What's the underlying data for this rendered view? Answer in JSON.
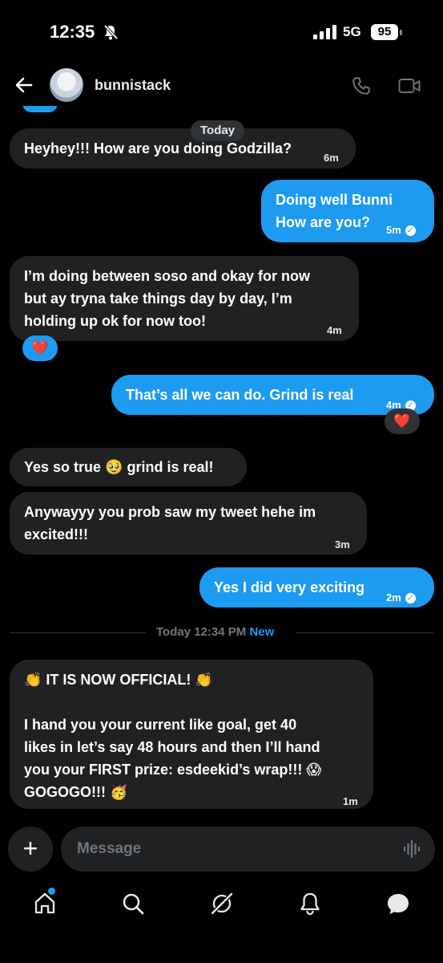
{
  "status_bar": {
    "time": "12:35",
    "network": "5G",
    "battery": "95"
  },
  "header": {
    "contact_name": "bunnistack"
  },
  "chat": {
    "today_label": "Today",
    "messages": [
      {
        "dir": "in",
        "text": "Heyhey!!! How are you doing Godzilla?",
        "time": "6m"
      },
      {
        "dir": "out",
        "text": "Doing well Bunni\nHow are you?",
        "time": "5m"
      },
      {
        "dir": "in",
        "text": "I’m doing between soso and okay for now\nbut ay tryna take things day by day, I’m\nholding up ok for now too!",
        "time": "4m",
        "reaction": "❤️"
      },
      {
        "dir": "out",
        "text": "That’s all we can do. Grind is real",
        "time": "4m",
        "reaction": "❤️"
      },
      {
        "dir": "in",
        "text": "Yes so true 🥹 grind is real!",
        "time": ""
      },
      {
        "dir": "in",
        "text": "Anywayyy you prob saw my tweet hehe im\nexcited!!!",
        "time": "3m"
      },
      {
        "dir": "out",
        "text": "Yes I did very exciting",
        "time": "2m"
      },
      {
        "dir": "in",
        "text": "👏 IT IS NOW OFFICIAL! 👏\n\nI hand you your current like goal, get 40\nlikes in let’s say 48 hours and then I’ll hand\nyou your FIRST prize: esdeekid’s wrap!!! 😱\nGOGOGO!!! 🥳",
        "time": "1m"
      }
    ],
    "divider": {
      "time": "Today 12:34 PM",
      "new_label": "New"
    }
  },
  "composer": {
    "placeholder": "Message"
  },
  "colors": {
    "accent": "#1d9bf0",
    "bubble_in": "#1f2123",
    "background": "#000000",
    "heart": "#f91880"
  },
  "tabs": [
    "home-icon",
    "search-icon",
    "grok-icon",
    "notifications-icon",
    "messages-icon"
  ]
}
